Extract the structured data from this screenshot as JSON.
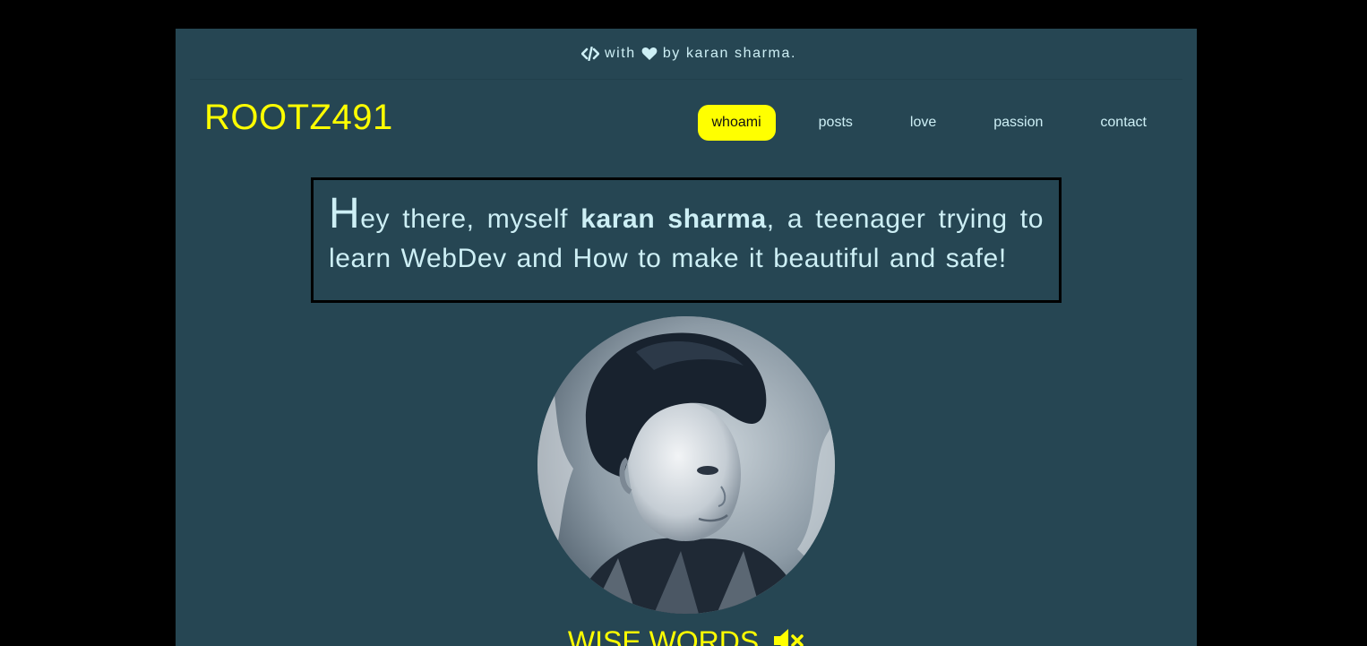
{
  "topbar": {
    "with_text": "with",
    "by_text": "by karan sharma.",
    "code_icon": "code-icon",
    "heart_icon": "heart-icon"
  },
  "header": {
    "logo": "ROOTZ491",
    "nav": [
      {
        "label": "whoami",
        "active": true
      },
      {
        "label": "posts"
      },
      {
        "label": "love"
      },
      {
        "label": "passion"
      },
      {
        "label": "contact"
      }
    ]
  },
  "intro": {
    "first_letter": "H",
    "text_part1": "ey there, myself ",
    "name": "karan sharma",
    "text_part2": ", a teenager trying to learn WebDev and How to make it beautiful and safe!"
  },
  "profile": {
    "image": "profile-photo"
  },
  "wise": {
    "title": "WISE WORDS",
    "icon": "mute-icon"
  },
  "colors": {
    "background": "#000000",
    "panel": "#264653",
    "accent": "#ffff00",
    "text": "#cdeff5"
  }
}
